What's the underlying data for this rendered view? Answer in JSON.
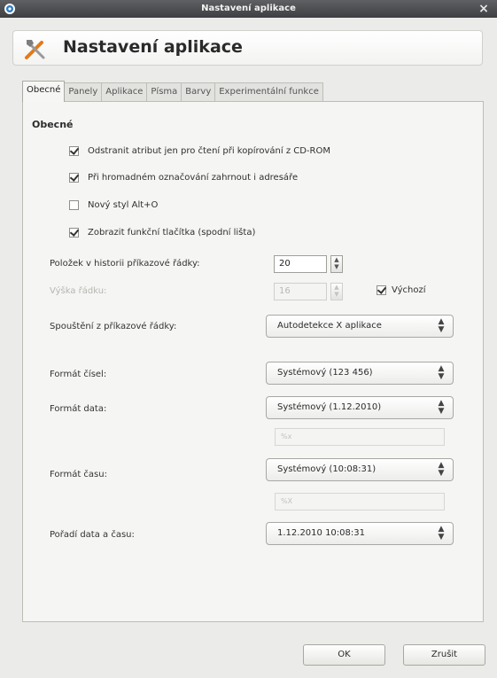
{
  "window": {
    "title": "Nastavení aplikace",
    "close_glyph": "×"
  },
  "header": {
    "title": "Nastavení aplikace",
    "icon": "tools-icon"
  },
  "tabs": [
    {
      "label": "Obecné",
      "active": true
    },
    {
      "label": "Panely",
      "active": false
    },
    {
      "label": "Aplikace",
      "active": false
    },
    {
      "label": "Písma",
      "active": false
    },
    {
      "label": "Barvy",
      "active": false
    },
    {
      "label": "Experimentální funkce",
      "active": false
    }
  ],
  "general": {
    "section_title": "Obecné",
    "checkboxes": [
      {
        "label": "Odstranit atribut jen pro čtení při kopírování z CD-ROM",
        "checked": true
      },
      {
        "label": "Při hromadném označování zahrnout i adresáře",
        "checked": true
      },
      {
        "label": "Nový styl Alt+O",
        "checked": false
      },
      {
        "label": "Zobrazit funkční tlačítka (spodní lišta)",
        "checked": true
      }
    ],
    "history": {
      "label": "Položek v historii příkazové řádky:",
      "value": "20"
    },
    "height": {
      "label": "Výška řádku:",
      "value": "16"
    },
    "default_checkbox": {
      "label": "Výchozí",
      "checked": true
    },
    "command_line": {
      "label": "Spouštění z příkazové řádky:",
      "value": "Autodetekce X aplikace"
    },
    "number_format": {
      "label": "Formát čísel:",
      "value": "Systémový (123 456)"
    },
    "date_format": {
      "label": "Formát data:",
      "value": "Systémový (1.12.2010)",
      "custom_placeholder": "%x"
    },
    "time_format": {
      "label": "Formát času:",
      "value": "Systémový (10:08:31)",
      "custom_placeholder": "%X"
    },
    "datetime_order": {
      "label": "Pořadí data a času:",
      "value": "1.12.2010 10:08:31"
    }
  },
  "buttons": {
    "ok": "OK",
    "cancel": "Zrušit"
  },
  "colors": {
    "titlebar": "#4d4e51",
    "accent": "#e07b1c"
  }
}
